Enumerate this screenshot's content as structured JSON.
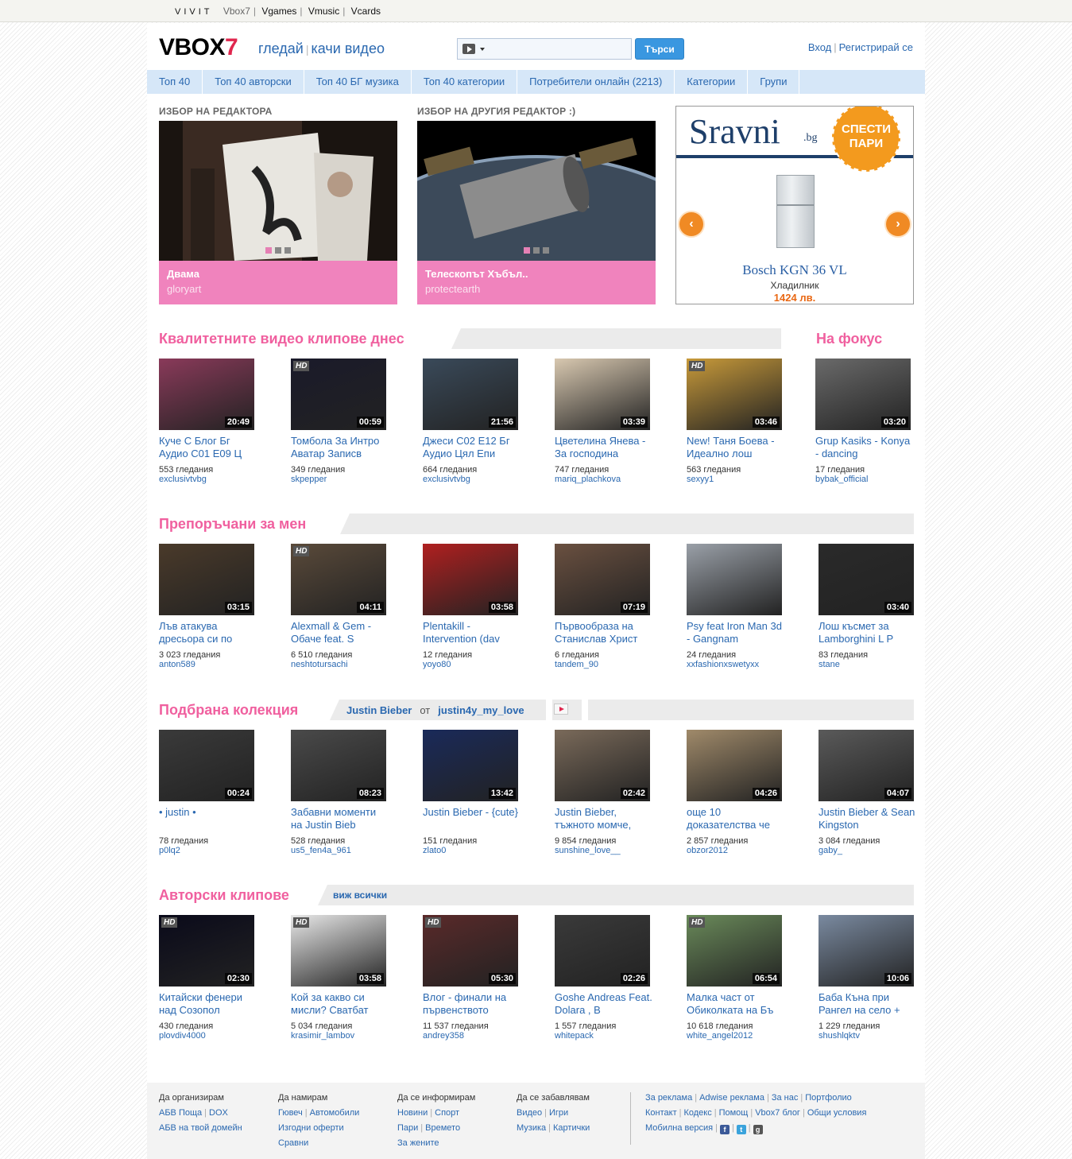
{
  "topbar": {
    "vivit": "VIVIT",
    "links": [
      "Vbox7",
      "Vgames",
      "Vmusic",
      "Vcards"
    ]
  },
  "header": {
    "logo_main": "VBOX",
    "logo_seven": "7",
    "watch": "гледай",
    "upload": "качи видео",
    "search_placeholder": "",
    "search_button": "Търси",
    "login": "Вход",
    "register": "Регистрирай се"
  },
  "nav": [
    "Топ 40",
    "Топ 40 авторски",
    "Топ 40 БГ музика",
    "Топ 40 категории",
    "Потребители онлайн (2213)",
    "Категории",
    "Групи"
  ],
  "picks": [
    {
      "heading": "Избор на редактора",
      "title": "Двама",
      "user": "gloryart"
    },
    {
      "heading": "Избор на другия редактор :)",
      "title": "Телескопът Хъбъл..",
      "user": "protectearth"
    }
  ],
  "ad": {
    "brand": "Sravni",
    "tld": ".bg",
    "badge_line1": "СПЕСТИ",
    "badge_line2": "ПАРИ",
    "model": "Bosch KGN 36 VL",
    "kind": "Хладилник",
    "price": "1424 лв.",
    "prev": "‹",
    "next": "›"
  },
  "sections": {
    "quality": {
      "title": "Квалитетните видео клипове днес",
      "videos": [
        {
          "title": "Куче С Блог Бг Аудио С01 Е09 Ц",
          "duration": "20:49",
          "hd": false,
          "views": "553 гледания",
          "user": "exclusivtvbg",
          "color": "#8a3a5a"
        },
        {
          "title": "Томбола За Интро Аватар Записв",
          "duration": "00:59",
          "hd": true,
          "views": "349 гледания",
          "user": "skpepper",
          "color": "#1a1a2a"
        },
        {
          "title": "Джеси С02 Е12 Бг Аудио Цял Епи",
          "duration": "21:56",
          "hd": false,
          "views": "664 гледания",
          "user": "exclusivtvbg",
          "color": "#3a4a5a"
        },
        {
          "title": "Цветелина Янева - За господина",
          "duration": "03:39",
          "hd": false,
          "views": "747 гледания",
          "user": "mariq_plachkova",
          "color": "#d8c8b0"
        }
      ]
    },
    "quality_more": {
      "videos": [
        {
          "title": "New! Таня Боева - Идеално лош",
          "duration": "03:46",
          "hd": true,
          "views": "563 гледания",
          "user": "sexyy1",
          "color": "#c89a3a"
        }
      ]
    },
    "focus": {
      "title": "На фокус",
      "videos": [
        {
          "title": "Grup Kasiks - Konya - dancing",
          "duration": "03:20",
          "hd": false,
          "views": "17 гледания",
          "user": "bybak_official",
          "color": "#6a6a6a"
        }
      ]
    },
    "recommended": {
      "title": "Препоръчани за мен",
      "videos": [
        {
          "title": "Лъв атакува дресьора си по",
          "duration": "03:15",
          "hd": false,
          "views": "3 023 гледания",
          "user": "anton589",
          "color": "#4a3a2a"
        },
        {
          "title": "Alexmall & Gem - Обаче feat. S",
          "duration": "04:11",
          "hd": true,
          "views": "6 510 гледания",
          "user": "neshtotursachi",
          "color": "#5a4a3a"
        },
        {
          "title": "Plentakill - Intervention (dav",
          "duration": "03:58",
          "hd": false,
          "views": "12 гледания",
          "user": "yoyo80",
          "color": "#b02020"
        },
        {
          "title": "Първообраза на Станислав Христ",
          "duration": "07:19",
          "hd": false,
          "views": "6 гледания",
          "user": "tandem_90",
          "color": "#6a5040"
        },
        {
          "title": "Psy feat Iron Man 3d - Gangnam",
          "duration": "",
          "hd": false,
          "views": "24 гледания",
          "user": "xxfashionxswetyxx",
          "color": "#9aa0a8"
        },
        {
          "title": "Лош късмет за Lamborghini L P",
          "duration": "03:40",
          "hd": false,
          "views": "83 гледания",
          "user": "stane",
          "color": "#2a2a2a"
        }
      ]
    },
    "collection": {
      "title": "Подбрана колекция",
      "name": "Justin Bieber",
      "from": "от",
      "author": "justin4y_my_love",
      "videos": [
        {
          "title": "• justin •",
          "duration": "00:24",
          "hd": false,
          "views": "78 гледания",
          "user": "p0lq2",
          "color": "#3a3a3a"
        },
        {
          "title": "Забавни моменти на Justin Bieb",
          "duration": "08:23",
          "hd": false,
          "views": "528 гледания",
          "user": "us5_fen4a_961",
          "color": "#4a4a4a"
        },
        {
          "title": "Justin Bieber - {cute}",
          "duration": "13:42",
          "hd": false,
          "views": "151 гледания",
          "user": "zlato0",
          "color": "#1a2a5a"
        },
        {
          "title": "Justin Bieber, тъжното момче,",
          "duration": "02:42",
          "hd": false,
          "views": "9 854 гледания",
          "user": "sunshine_love__",
          "color": "#7a6a5a"
        },
        {
          "title": "още 10 доказателства че",
          "duration": "04:26",
          "hd": false,
          "views": "2 857 гледания",
          "user": "obzor2012",
          "color": "#a08a6a"
        },
        {
          "title": "Justin Bieber & Sean Kingston",
          "duration": "04:07",
          "hd": false,
          "views": "3 084 гледания",
          "user": "gaby_",
          "color": "#5a5a5a"
        }
      ]
    },
    "authors": {
      "title": "Авторски клипове",
      "see_all": "виж всички",
      "videos": [
        {
          "title": "Китайски фенери над Созопол",
          "duration": "02:30",
          "hd": true,
          "views": "430 гледания",
          "user": "plovdiv4000",
          "color": "#0a0a1a"
        },
        {
          "title": "Кой за какво си мисли? Сватбат",
          "duration": "03:58",
          "hd": true,
          "views": "5 034 гледания",
          "user": "krasimir_lambov",
          "color": "#e8e8e8"
        },
        {
          "title": "Влог - финали на първенството",
          "duration": "05:30",
          "hd": true,
          "views": "11 537 гледания",
          "user": "andrey358",
          "color": "#5a2a2a"
        },
        {
          "title": "Goshe Andreas Feat. Dolara , B",
          "duration": "02:26",
          "hd": false,
          "views": "1 557 гледания",
          "user": "whitepack",
          "color": "#3a3a3a"
        },
        {
          "title": "Малка част от Обиколката на Бъ",
          "duration": "06:54",
          "hd": true,
          "views": "10 618 гледания",
          "user": "white_angel2012",
          "color": "#6a8a5a"
        },
        {
          "title": "Баба Къна при Рангел на село +",
          "duration": "10:06",
          "hd": false,
          "views": "1 229 гледания",
          "user": "shushlqktv",
          "color": "#7a8aa0"
        }
      ]
    }
  },
  "footer": {
    "col1": {
      "head": "Да организирам",
      "links": [
        "АБВ Поща",
        "DOX",
        "АБВ на твой домейн"
      ]
    },
    "col2": {
      "head": "Да намирам",
      "links": [
        "Гювеч",
        "Автомобили",
        "Изгодни оферти",
        "Сравни"
      ]
    },
    "col3": {
      "head": "Да се информирам",
      "links": [
        "Новини",
        "Спорт",
        "Пари",
        "Времето",
        "За жените"
      ]
    },
    "col4": {
      "head": "Да се забавлявам",
      "links": [
        "Видео",
        "Игри",
        "Музика",
        "Картички"
      ]
    },
    "col5": {
      "row1": [
        "За реклама",
        "Adwise реклама",
        "За нас",
        "Портфолио"
      ],
      "row2": [
        "Контакт",
        "Кодекс",
        "Помощ",
        "Vbox7 блог",
        "Общи условия"
      ],
      "row3": [
        "Мобилна версия"
      ]
    }
  }
}
